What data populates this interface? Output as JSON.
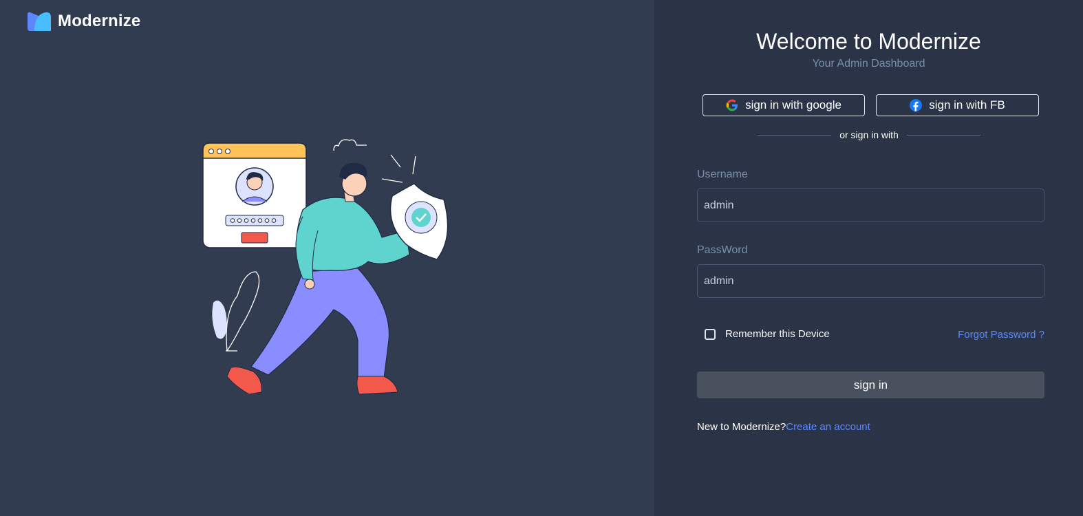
{
  "brand": {
    "name": "Modernize",
    "logo_icon": "modernize-logo-icon"
  },
  "login": {
    "title": "Welcome to Modernize",
    "subtitle": "Your Admin Dashboard",
    "google_label": "sign in with google",
    "fb_label": "sign in with FB",
    "divider_text": "or sign in with",
    "username_label": "Username",
    "username_value": "admin",
    "password_label": "PassWord",
    "password_value": "admin",
    "remember_label": "Remember this Device",
    "forgot_label": "Forgot Password ?",
    "signin_label": "sign in",
    "new_user_text": "New to Modernize?",
    "create_account_label": "Create an account"
  },
  "colors": {
    "left_bg": "#323c50",
    "right_bg": "#2b3446",
    "link": "#5d87ff",
    "muted": "#7c8fac",
    "button_bg": "#49505e"
  },
  "icons": [
    "google-icon",
    "facebook-icon",
    "checkbox-icon"
  ],
  "illustration": {
    "name": "security-login-illustration"
  }
}
